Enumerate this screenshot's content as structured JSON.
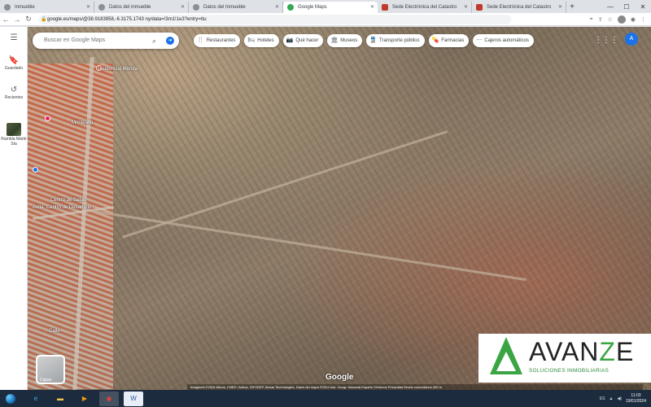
{
  "browser": {
    "tabs": [
      {
        "label": "Inmueble",
        "icon": "globe-icon",
        "active": false
      },
      {
        "label": "Datos del inmueble",
        "icon": "globe-icon",
        "active": false
      },
      {
        "label": "Datos del Inmueble",
        "icon": "globe-icon",
        "active": false
      },
      {
        "label": "Google Maps",
        "icon": "maps-icon",
        "active": true
      },
      {
        "label": "Sede Electrónica del Catastro",
        "icon": "catastro-icon",
        "active": false
      },
      {
        "label": "Sede Electrónica del Catastro",
        "icon": "catastro-icon",
        "active": false
      }
    ],
    "new_tab": "+",
    "window_controls": [
      "—",
      "☐",
      "✕"
    ],
    "address": "google.es/maps/@38.9183958,-6.3175.1743 ny/data=!3m1!1e3?entry=ttu"
  },
  "sidebar": {
    "menu_icon": "☰",
    "items": [
      {
        "label": "Guardado",
        "icon": "bookmark-icon"
      },
      {
        "label": "Recientes",
        "icon": "history-icon"
      },
      {
        "label": "Rambla Mártir Sta",
        "icon": "place-thumbnail"
      }
    ]
  },
  "search": {
    "placeholder": "Buscar en Google Maps",
    "search_icon": "⌕",
    "directions_icon": "➜"
  },
  "chips": [
    {
      "label": "Restaurantes",
      "icon": "utensils-icon",
      "glyph": "🍴"
    },
    {
      "label": "Hoteles",
      "icon": "bed-icon",
      "glyph": "🛏"
    },
    {
      "label": "Qué hacer",
      "icon": "camera-icon",
      "glyph": "📷"
    },
    {
      "label": "Museos",
      "icon": "museum-icon",
      "glyph": "🏛"
    },
    {
      "label": "Transporte público",
      "icon": "train-icon",
      "glyph": "🚆"
    },
    {
      "label": "Farmacias",
      "icon": "pharmacy-icon",
      "glyph": "💊"
    },
    {
      "label": "Cajeros automáticos",
      "icon": "atm-icon",
      "glyph": "⋯"
    }
  ],
  "account_initial": "A",
  "map": {
    "town_labels": [
      "Residencial Mérida",
      "Montealto",
      "Centro de Salud",
      "Avda. Centro de Desarrollo",
      "Calle"
    ],
    "layers_label": "Capas",
    "google_logo": "Google",
    "copyright": "Imágenes ©2024 Airbus, CNES / Airbus, IGP/IGEP, Maxar Technologies, Datos del mapa ©2024 Inst. Geogr. Nacional   España   Términos   Privacidad   Enviar comentarios   200 m"
  },
  "brand": {
    "name_part1": "AVAN",
    "name_highlight": "Z",
    "name_part2": "E",
    "tagline": "SOLUCIONES INMOBILIARIAS",
    "color": "#3aa542"
  },
  "taskbar": {
    "apps": [
      "ie-icon",
      "explorer-icon",
      "media-icon",
      "chrome-icon",
      "word-icon"
    ],
    "tray_text": "ES",
    "time": "11:03",
    "date": "19/01/2024"
  }
}
